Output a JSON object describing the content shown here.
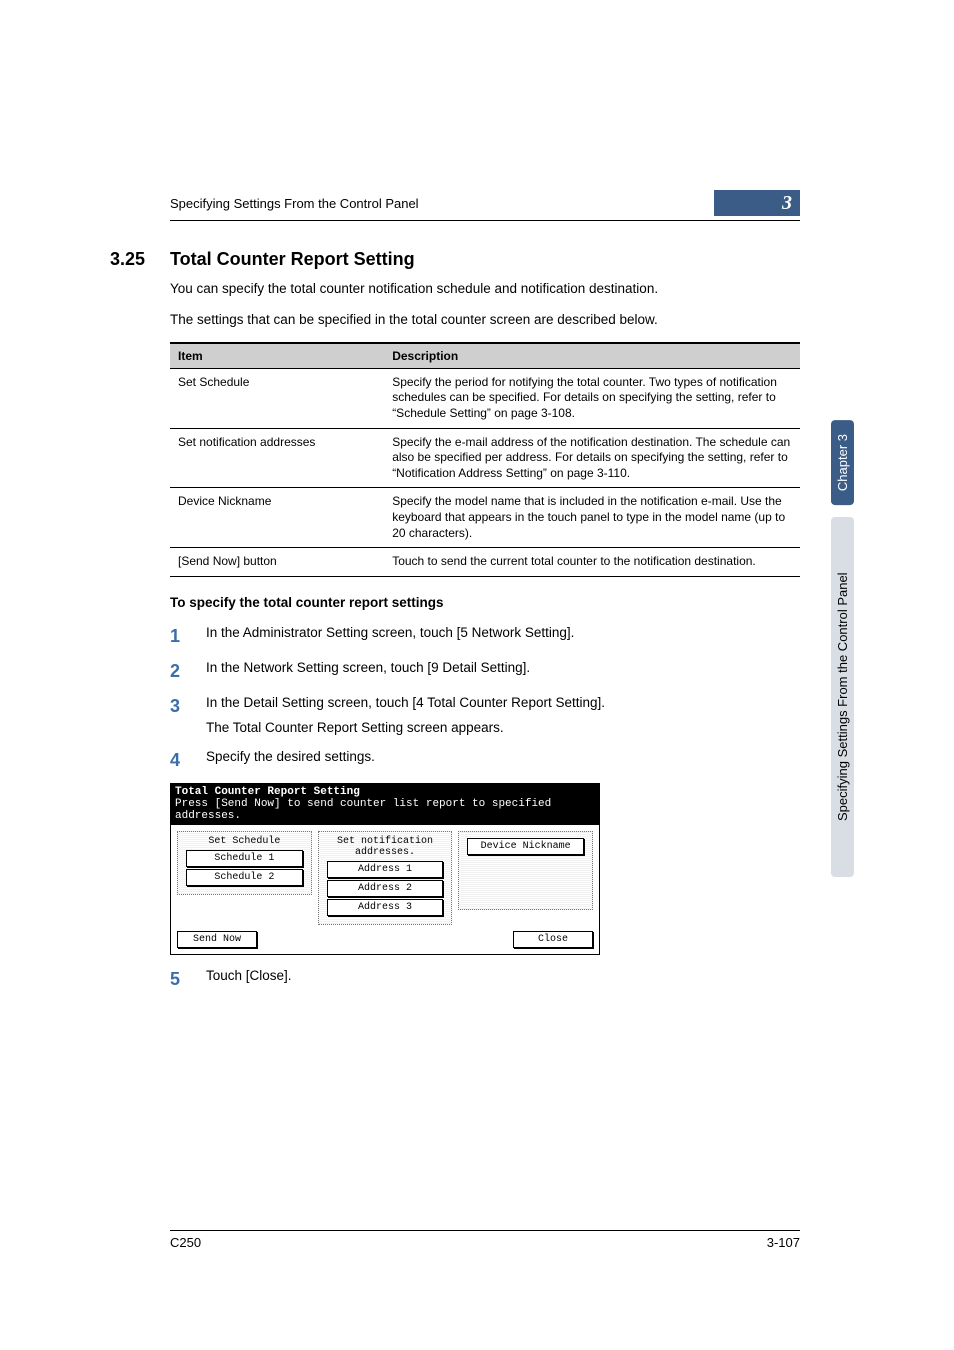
{
  "runningHead": "Specifying Settings From the Control Panel",
  "chapterBadge": "3",
  "section": {
    "num": "3.25",
    "title": "Total Counter Report Setting"
  },
  "intro1": "You can specify the total counter notification schedule and notification destination.",
  "intro2": "The settings that can be specified in the total counter screen are described below.",
  "table": {
    "headers": [
      "Item",
      "Description"
    ],
    "rows": [
      {
        "item": "Set Schedule",
        "desc": "Specify the period for notifying the total counter. Two types of notification schedules can be specified. For details on specifying the setting, refer to “Schedule Setting” on page 3-108."
      },
      {
        "item": "Set notification addresses",
        "desc": "Specify the e-mail address of the notification destination. The schedule can also be specified per address. For details on specifying the setting, refer to “Notification Address Setting” on page 3-110."
      },
      {
        "item": "Device Nickname",
        "desc": "Specify the model name that is included in the notification e-mail. Use the keyboard that appears in the touch panel to type in the model name (up to 20 characters)."
      },
      {
        "item": "[Send Now] button",
        "desc": "Touch to send the current total counter to the notification destination."
      }
    ]
  },
  "subhead": "To specify the total counter report settings",
  "steps": [
    {
      "n": "1",
      "text": "In the Administrator Setting screen, touch [5 Network Setting]."
    },
    {
      "n": "2",
      "text": "In the Network Setting screen, touch [9 Detail Setting]."
    },
    {
      "n": "3",
      "text": "In the Detail Setting screen, touch [4 Total Counter Report Setting].",
      "sub": "The Total Counter Report Setting screen appears."
    },
    {
      "n": "4",
      "text": "Specify the desired settings."
    },
    {
      "n": "5",
      "text": "Touch [Close]."
    }
  ],
  "screenshot": {
    "title": "Total Counter Report Setting",
    "subtitle": "Press [Send Now] to send counter list report to specified addresses.",
    "col1": {
      "label": "Set Schedule",
      "b1": "Schedule 1",
      "b2": "Schedule 2"
    },
    "col2": {
      "label": "Set notification addresses.",
      "b1": "Address 1",
      "b2": "Address 2",
      "b3": "Address 3"
    },
    "col3": {
      "b1": "Device Nickname"
    },
    "sendNow": "Send Now",
    "close": "Close"
  },
  "footer": {
    "left": "C250",
    "right": "3-107"
  },
  "sideTabs": {
    "dark": "Chapter 3",
    "light": "Specifying Settings From the Control Panel"
  }
}
